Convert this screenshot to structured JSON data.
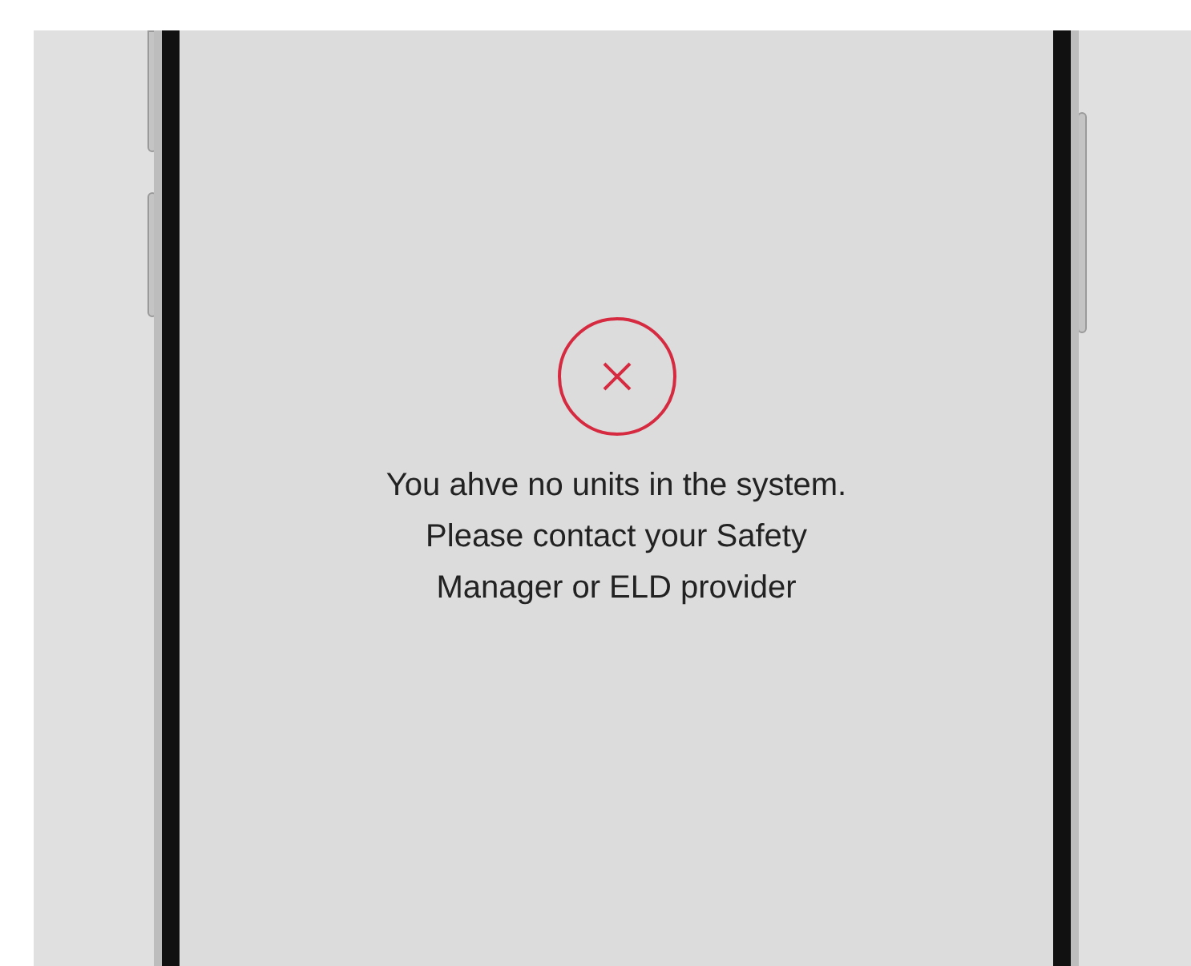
{
  "message": "You ahve no units in the system.\nPlease contact your Safety\nManager or ELD provider"
}
